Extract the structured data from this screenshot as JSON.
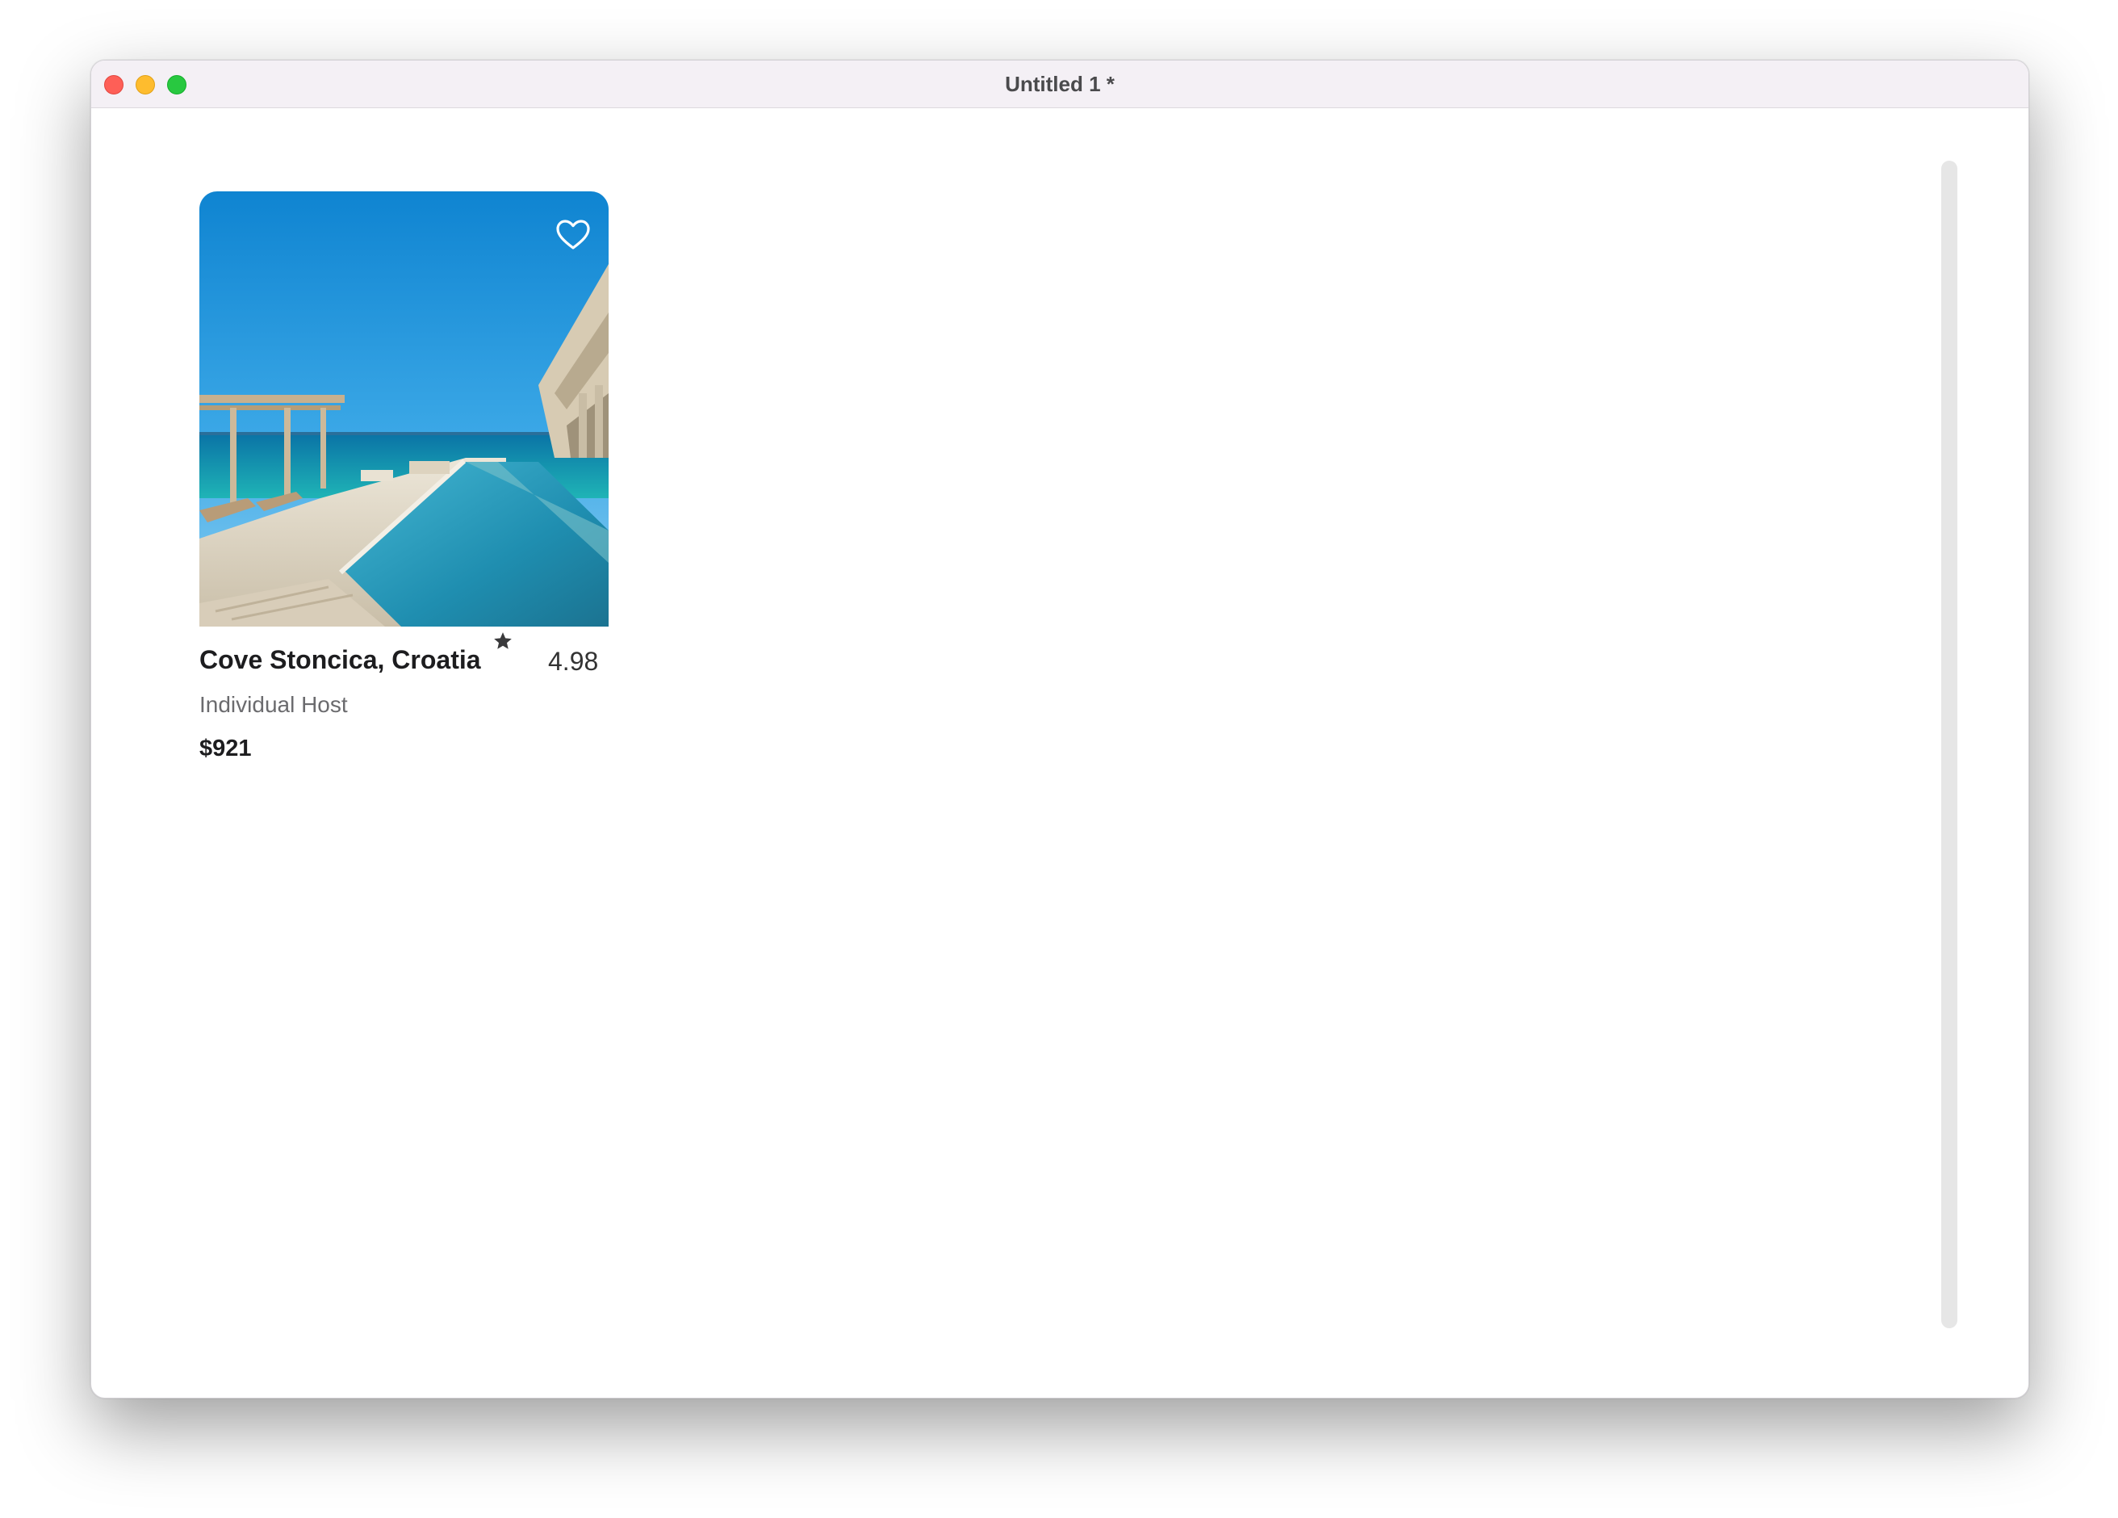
{
  "window": {
    "title": "Untitled 1 *"
  },
  "listing": {
    "name": "Cove Stoncica, Croatia",
    "rating": "4.98",
    "host_type": "Individual Host",
    "price": "$921",
    "favorite_icon": "heart-outline-icon",
    "rating_icon": "star-icon"
  },
  "colors": {
    "close": "#fe5f57",
    "minimize": "#febc2e",
    "zoom": "#28c840"
  }
}
